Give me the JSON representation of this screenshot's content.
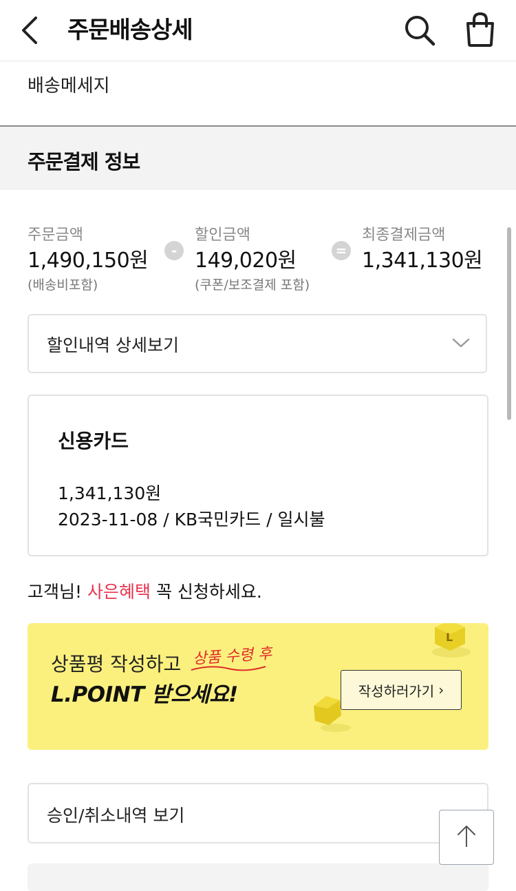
{
  "header": {
    "title": "주문배송상세"
  },
  "delivery": {
    "message": "배송메세지"
  },
  "section": {
    "title": "주문결제 정보"
  },
  "amounts": {
    "order": {
      "label": "주문금액",
      "value": "1,490,150원",
      "note": "(배송비포함)"
    },
    "discount": {
      "label": "할인금액",
      "value": "149,020원",
      "note": "(쿠폰/보조결제 포함)"
    },
    "final": {
      "label": "최종결제금액",
      "value": "1,341,130원"
    },
    "minus_symbol": "-",
    "equals_symbol": "="
  },
  "discount_detail": {
    "label": "할인내역 상세보기"
  },
  "payment": {
    "method": "신용카드",
    "amount": "1,341,130원",
    "detail": "2023-11-08 / KB국민카드 / 일시불"
  },
  "benefit": {
    "prefix": "고객님! ",
    "highlight": "사은혜택",
    "suffix": " 꼭 신청하세요."
  },
  "banner": {
    "line1": "상품평 작성하고",
    "handwritten": "상품 수령 후",
    "line2": "L.POINT 받으세요!",
    "cta": "작성하러가기",
    "cta_arrow": "›",
    "bg_color": "#fbf07e"
  },
  "approval": {
    "label": "승인/취소내역 보기"
  },
  "colors": {
    "highlight": "#e8344e"
  }
}
